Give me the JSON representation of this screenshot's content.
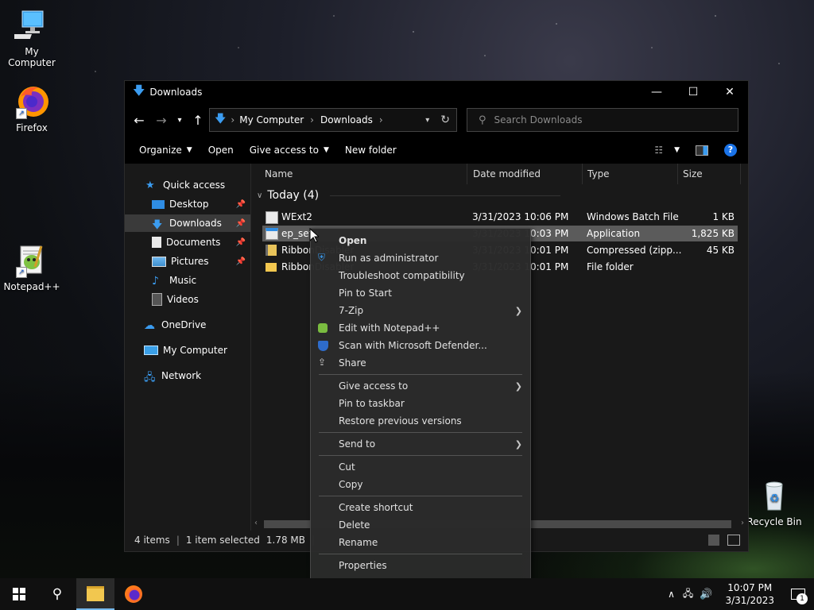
{
  "desktop": {
    "icons": [
      {
        "label": "My Computer"
      },
      {
        "label": "Firefox"
      },
      {
        "label": "Notepad++"
      },
      {
        "label": "Recycle Bin"
      }
    ]
  },
  "window": {
    "title": "Downloads",
    "address": {
      "segments": [
        "My Computer",
        "Downloads"
      ]
    },
    "search_placeholder": "Search Downloads",
    "commands": {
      "organize": "Organize",
      "open": "Open",
      "give_access": "Give access to",
      "new_folder": "New folder"
    }
  },
  "nav": {
    "items": [
      {
        "label": "Quick access"
      },
      {
        "label": "Desktop"
      },
      {
        "label": "Downloads"
      },
      {
        "label": "Documents"
      },
      {
        "label": "Pictures"
      },
      {
        "label": "Music"
      },
      {
        "label": "Videos"
      },
      {
        "label": "OneDrive"
      },
      {
        "label": "My Computer"
      },
      {
        "label": "Network"
      }
    ]
  },
  "columns": {
    "name": "Name",
    "date": "Date modified",
    "type": "Type",
    "size": "Size"
  },
  "group": {
    "label": "Today (4)"
  },
  "files": [
    {
      "name": "WExt2",
      "date": "3/31/2023 10:06 PM",
      "type": "Windows Batch File",
      "size": "1 KB"
    },
    {
      "name": "ep_setu",
      "date": "3/31/2023 10:03 PM",
      "type": "Application",
      "size": "1,825 KB"
    },
    {
      "name": "RibbonDisabler",
      "date": "3/31/2023 10:01 PM",
      "type": "Compressed (zipp...",
      "size": "45 KB"
    },
    {
      "name": "RibbonDisabler",
      "date": "3/31/2023 10:01 PM",
      "type": "File folder",
      "size": ""
    }
  ],
  "status": {
    "items": "4 items",
    "selected": "1 item selected",
    "size": "1.78 MB"
  },
  "context_menu": {
    "open": "Open",
    "run_admin": "Run as administrator",
    "troubleshoot": "Troubleshoot compatibility",
    "pin_start": "Pin to Start",
    "zip": "7-Zip",
    "notepad": "Edit with Notepad++",
    "defender": "Scan with Microsoft Defender...",
    "share": "Share",
    "give_access": "Give access to",
    "pin_taskbar": "Pin to taskbar",
    "restore": "Restore previous versions",
    "send_to": "Send to",
    "cut": "Cut",
    "copy": "Copy",
    "create_shortcut": "Create shortcut",
    "delete": "Delete",
    "rename": "Rename",
    "properties": "Properties"
  },
  "taskbar": {
    "time": "10:07 PM",
    "date": "3/31/2023",
    "notification_count": "1"
  },
  "colors": {
    "accent": "#76b9ed",
    "selection": "#5b5b5b",
    "folder": "#f2c74f"
  }
}
